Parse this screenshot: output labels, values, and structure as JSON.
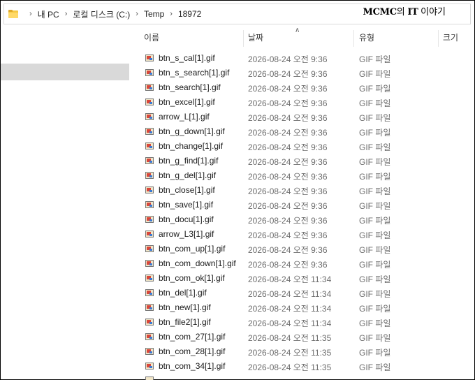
{
  "breadcrumb": {
    "items": [
      "내 PC",
      "로컬 디스크 (C:)",
      "Temp",
      "18972"
    ]
  },
  "watermark": {
    "bold": "MCMC",
    "rest": "의 ",
    "bold2": "IT",
    "rest2": " 이야기"
  },
  "columns": {
    "name": "이름",
    "date": "날짜",
    "type": "유형",
    "size": "크기"
  },
  "files": [
    {
      "name": "btn_s_cal[1].gif",
      "date": "2026-08-24 오전 9:36",
      "type": "GIF 파일"
    },
    {
      "name": "btn_s_search[1].gif",
      "date": "2026-08-24 오전 9:36",
      "type": "GIF 파일"
    },
    {
      "name": "btn_search[1].gif",
      "date": "2026-08-24 오전 9:36",
      "type": "GIF 파일"
    },
    {
      "name": "btn_excel[1].gif",
      "date": "2026-08-24 오전 9:36",
      "type": "GIF 파일"
    },
    {
      "name": "arrow_L[1].gif",
      "date": "2026-08-24 오전 9:36",
      "type": "GIF 파일"
    },
    {
      "name": "btn_g_down[1].gif",
      "date": "2026-08-24 오전 9:36",
      "type": "GIF 파일"
    },
    {
      "name": "btn_change[1].gif",
      "date": "2026-08-24 오전 9:36",
      "type": "GIF 파일"
    },
    {
      "name": "btn_g_find[1].gif",
      "date": "2026-08-24 오전 9:36",
      "type": "GIF 파일"
    },
    {
      "name": "btn_g_del[1].gif",
      "date": "2026-08-24 오전 9:36",
      "type": "GIF 파일"
    },
    {
      "name": "btn_close[1].gif",
      "date": "2026-08-24 오전 9:36",
      "type": "GIF 파일"
    },
    {
      "name": "btn_save[1].gif",
      "date": "2026-08-24 오전 9:36",
      "type": "GIF 파일"
    },
    {
      "name": "btn_docu[1].gif",
      "date": "2026-08-24 오전 9:36",
      "type": "GIF 파일"
    },
    {
      "name": "arrow_L3[1].gif",
      "date": "2026-08-24 오전 9:36",
      "type": "GIF 파일"
    },
    {
      "name": "btn_com_up[1].gif",
      "date": "2026-08-24 오전 9:36",
      "type": "GIF 파일"
    },
    {
      "name": "btn_com_down[1].gif",
      "date": "2026-08-24 오전 9:36",
      "type": "GIF 파일"
    },
    {
      "name": "btn_com_ok[1].gif",
      "date": "2026-08-24 오전 11:34",
      "type": "GIF 파일"
    },
    {
      "name": "btn_del[1].gif",
      "date": "2026-08-24 오전 11:34",
      "type": "GIF 파일"
    },
    {
      "name": "btn_new[1].gif",
      "date": "2026-08-24 오전 11:34",
      "type": "GIF 파일"
    },
    {
      "name": "btn_file2[1].gif",
      "date": "2026-08-24 오전 11:34",
      "type": "GIF 파일"
    },
    {
      "name": "btn_com_27[1].gif",
      "date": "2026-08-24 오전 11:35",
      "type": "GIF 파일"
    },
    {
      "name": "btn_com_28[1].gif",
      "date": "2026-08-24 오전 11:35",
      "type": "GIF 파일"
    },
    {
      "name": "btn_com_34[1].gif",
      "date": "2026-08-24 오전 11:35",
      "type": "GIF 파일"
    }
  ],
  "icons": {
    "folder": "folder-icon",
    "file": "gif-image-file-icon",
    "separator": "chevron-right-icon",
    "sort": "sort-ascending-icon"
  },
  "colors": {
    "selection": "#d9d9d9",
    "folder": "#f5c842"
  }
}
